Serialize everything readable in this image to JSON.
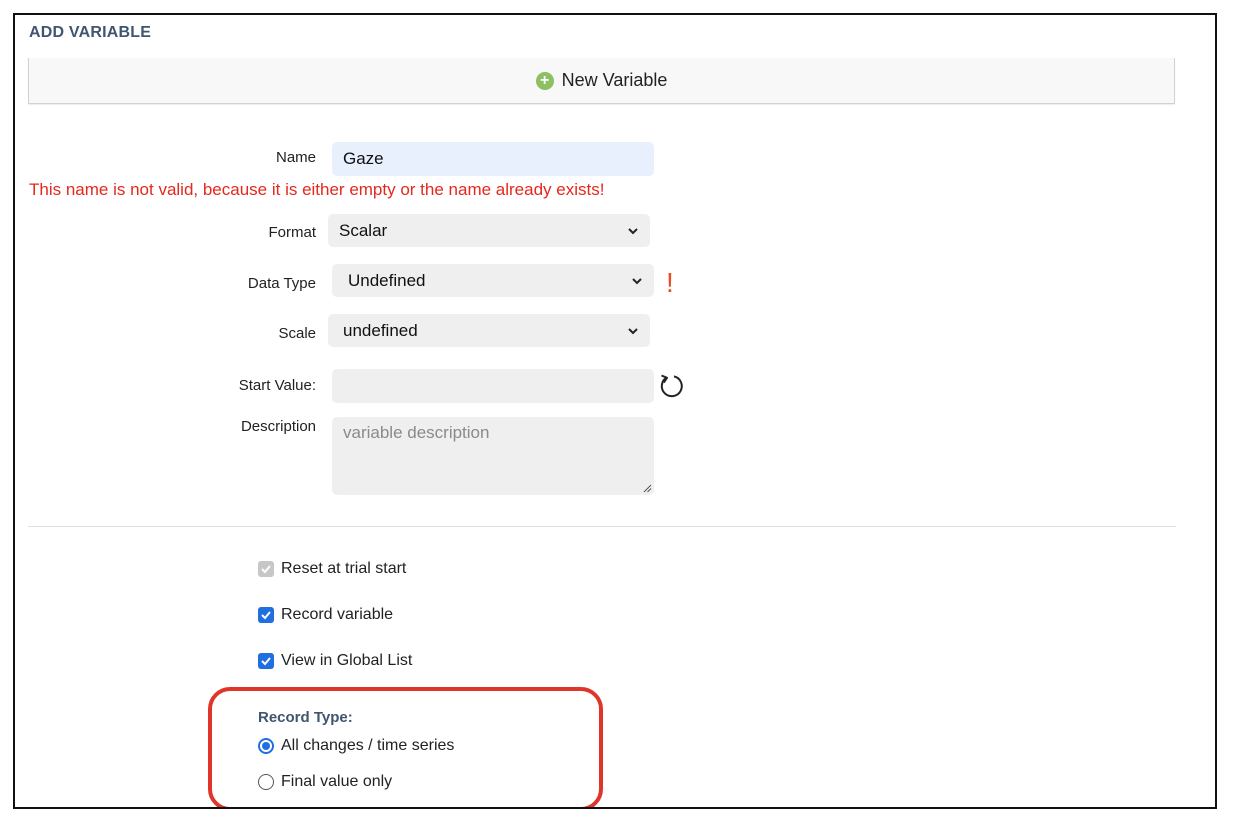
{
  "section": {
    "title": "ADD VARIABLE"
  },
  "new_variable": {
    "label": "New Variable",
    "icon": "plus-circle-icon",
    "icon_color": "#8dc063"
  },
  "form": {
    "name": {
      "label": "Name",
      "value": "Gaze"
    },
    "error": "This name is not valid, because it is either empty or the name already exists!",
    "format": {
      "label": "Format",
      "value": "Scalar"
    },
    "data_type": {
      "label": "Data Type",
      "value": "Undefined",
      "warning": "!"
    },
    "scale": {
      "label": "Scale",
      "value": "undefined"
    },
    "start_value": {
      "label": "Start Value:",
      "value": ""
    },
    "description": {
      "label": "Description",
      "placeholder": "variable description"
    }
  },
  "options": {
    "reset_at_trial_start": {
      "label": "Reset at trial start",
      "checked": true,
      "disabled": true
    },
    "record_variable": {
      "label": "Record variable",
      "checked": true
    },
    "view_in_global_list": {
      "label": "View in Global List",
      "checked": true
    }
  },
  "record_type": {
    "title": "Record Type:",
    "options": [
      {
        "label": "All changes / time series",
        "selected": true
      },
      {
        "label": "Final value only",
        "selected": false
      }
    ]
  },
  "colors": {
    "accent": "#1f6fe0",
    "error": "#e5281c",
    "highlight": "#e0352a",
    "title": "#3f5570"
  }
}
